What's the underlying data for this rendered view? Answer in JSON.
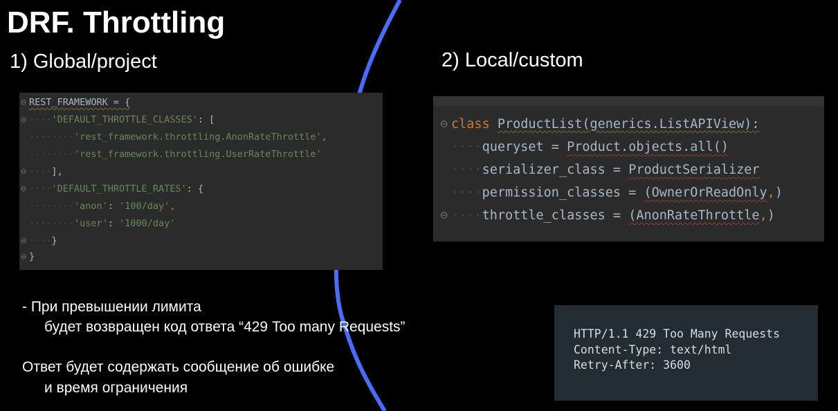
{
  "slide": {
    "title": "DRF. Throttling",
    "section_global": "1) Global/project",
    "section_local": "2) Local/custom",
    "accent_color": "#4a6cf7"
  },
  "global_code": {
    "l1": "REST_FRAMEWORK = {",
    "l2_key": "'DEFAULT_THROTTLE_CLASSES'",
    "l2_rest": ": [",
    "l3": "'rest_framework.throttling.AnonRateThrottle'",
    "l4": "'rest_framework.throttling.UserRateThrottle'",
    "l5": "],",
    "l6_key": "'DEFAULT_THROTTLE_RATES'",
    "l6_rest": ": {",
    "l7_key": "'anon'",
    "l7_val": "'100/day'",
    "l8_key": "'user'",
    "l8_val": "'1000/day'",
    "l9": "}",
    "l10": "}"
  },
  "local_code": {
    "kw_class": "class",
    "class_decl": "ProductList(generics.ListAPIView):",
    "queryset_name": "queryset",
    "queryset_val": "Product.objects.all()",
    "serializer_name": "serializer_class",
    "serializer_val": "ProductSerializer",
    "permission_name": "permission_classes",
    "permission_val": "(OwnerOrReadOnly",
    "throttle_name": "throttle_classes",
    "throttle_val": "(AnonRateThrottle",
    "equals": " = ",
    "comma": ",",
    "close_paren": ")"
  },
  "notes": {
    "n1": "- При превышении лимита",
    "n2": "будет возвращен код ответа “429 Too many Requests”",
    "n3": "Ответ будет содержать  сообщение об ошибке",
    "n4": "и время ограничения"
  },
  "http_response": {
    "status_line": "HTTP/1.1 429 Too Many Requests",
    "content_type": "Content-Type: text/html",
    "retry_after": "Retry-After: 3600"
  }
}
